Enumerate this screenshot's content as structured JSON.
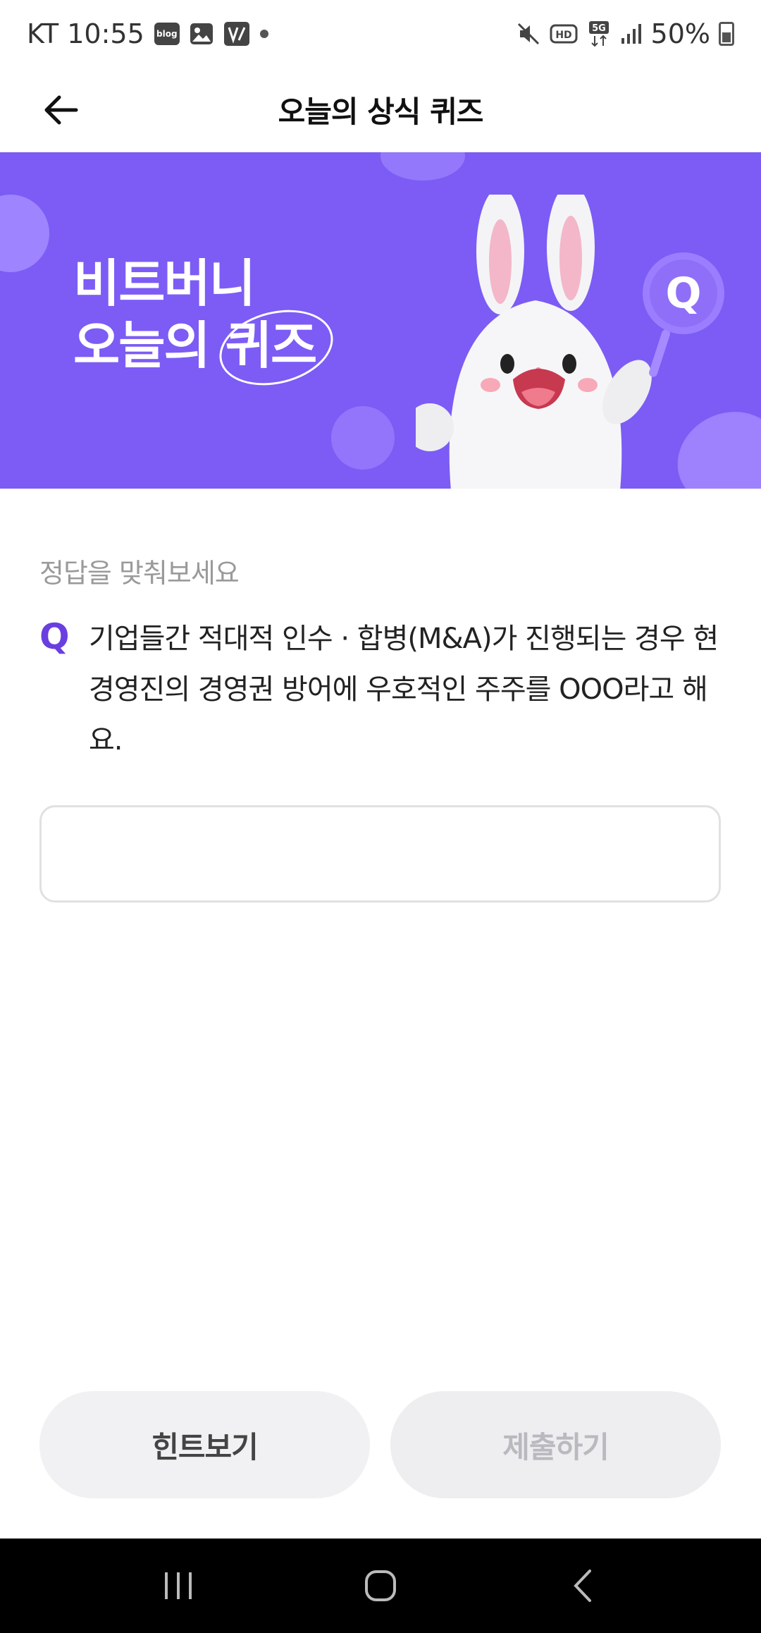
{
  "status_bar": {
    "carrier_time": "KT 10:55",
    "battery": "50%",
    "icons": [
      "blog-icon",
      "gallery-icon",
      "app-icon",
      "mute-icon",
      "hd-icon",
      "5g-icon",
      "signal-icon",
      "battery-icon"
    ]
  },
  "header": {
    "title": "오늘의 상식 퀴즈",
    "back_icon": "arrow-left-icon"
  },
  "banner": {
    "line1": "비트버니",
    "line2_prefix": "오늘의 ",
    "line2_highlight": "퀴즈",
    "colors": {
      "background": "#7c5cf5",
      "coin": "#a58bff"
    }
  },
  "quiz": {
    "instruction": "정답을 맞춰보세요",
    "q_label": "Q",
    "question": "기업들간 적대적 인수 · 합병(M&A)가 진행되는 경우 현 경영진의 경영권 방어에 우호적인 주주를 OOO라고 해요.",
    "answer_value": "",
    "answer_placeholder": ""
  },
  "actions": {
    "hint_label": "힌트보기",
    "submit_label": "제출하기"
  },
  "nav_bar": {
    "icons": [
      "recent-apps-icon",
      "home-icon",
      "back-icon"
    ]
  },
  "colors": {
    "accent": "#6a3fe0",
    "button_bg": "#f1f1f3",
    "disabled_text": "#b9b9bf"
  }
}
